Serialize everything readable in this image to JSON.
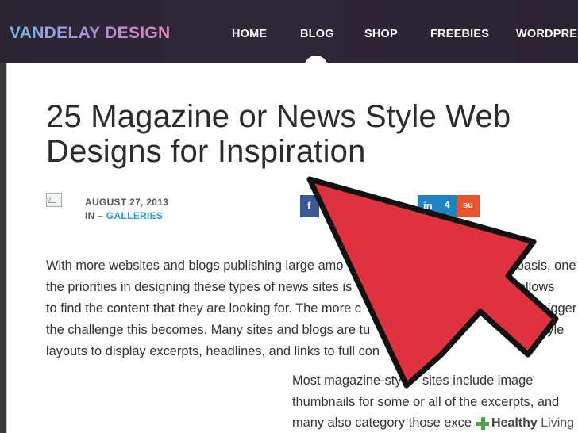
{
  "site": {
    "logo": "VANDELAY DESIGN"
  },
  "nav": {
    "items": [
      "HOME",
      "BLOG",
      "SHOP",
      "FREEBIES",
      "WORDPRE"
    ]
  },
  "article": {
    "title_line1": "25 Magazine or News Style Web",
    "title_line2": "Designs for Inspiration",
    "date": "AUGUST 27, 2013",
    "category_prefix": "IN – ",
    "category": "GALLERIES",
    "paragraph1_lines": [
      "With more websites and blogs publishing large amo",
      "the priorities in designing these types of news sites is",
      "to find the content that they are looking for. The more c",
      "the challenge this becomes. Many sites and blogs are tu",
      "layouts to display excerpts, headlines, and links to full con"
    ],
    "paragraph1_right_fragments": [
      "y basis, one of",
      "that allows visitors",
      "ed, the bigger",
      "ws style",
      ""
    ],
    "paragraph2_lines": [
      "Most magazine-sty",
      "thumbnails for some or all of the excerpts, and",
      "many also category those exce"
    ],
    "paragraph2_right_fragments": [
      "sites include image",
      "",
      ""
    ]
  },
  "share": {
    "facebook_icon": "f",
    "linkedin_label": "in",
    "linkedin_count": "4",
    "stumbleupon_icon": "su"
  },
  "colors": {
    "header_bg": "#2b2333",
    "link_blue": "#2b9bd6",
    "arrow_red": "#e0313f",
    "facebook_blue": "#3b5998",
    "linkedin_blue": "#1e83c2",
    "stumble_orange": "#e8532a"
  },
  "watermark": {
    "brand_bold": "Healthy",
    "brand_light": "Living"
  }
}
